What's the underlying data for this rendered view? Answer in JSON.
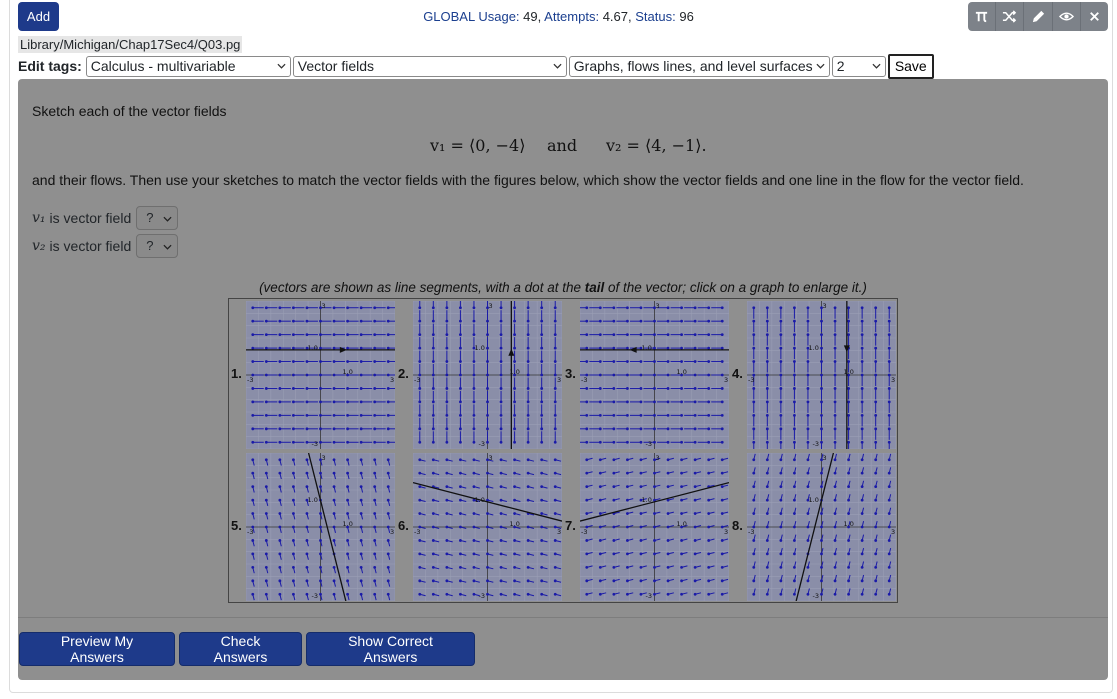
{
  "header": {
    "add_label": "Add",
    "usage": {
      "global_label": "GLOBAL Usage:",
      "global_value": "49,",
      "attempts_label": "Attempts:",
      "attempts_value": "4.67,",
      "status_label": "Status:",
      "status_value": "96"
    },
    "tools": [
      "pi-icon",
      "shuffle-icon",
      "pencil-icon",
      "eye-icon",
      "close-icon"
    ]
  },
  "file_path": "Library/Michigan/Chap17Sec4/Q03.pg",
  "tags": {
    "label": "Edit tags:",
    "subject": "Calculus - multivariable",
    "chapter": "Vector fields",
    "section": "Graphs, flows lines, and level surfaces",
    "level": "2",
    "save_label": "Save"
  },
  "problem": {
    "intro": "Sketch each of the vector fields",
    "v1_def": "v₁ = ⟨0, −4⟩",
    "and_word": "and",
    "v2_def": "v₂ = ⟨4, −1⟩.",
    "body": "and their flows. Then use your sketches to match the vector fields with the figures below, which show the vector fields and one line in the flow for the vector field.",
    "answers": [
      {
        "var": "v₁",
        "text": "is vector field",
        "value": "?"
      },
      {
        "var": "v₂",
        "text": "is vector field",
        "value": "?"
      }
    ],
    "caption_pre": "(vectors are shown as line segments, with a dot at the",
    "caption_bold": "tail",
    "caption_post": "of the vector; click on a graph to enlarge it.)",
    "graphs": [
      {
        "num": "1.",
        "axis_max": "3",
        "axis_min": "-3",
        "tick": "1.0"
      },
      {
        "num": "2.",
        "axis_max": "3",
        "axis_min": "-3",
        "tick": "1.0"
      },
      {
        "num": "3.",
        "axis_max": "3",
        "axis_min": "-3",
        "tick": "1.0"
      },
      {
        "num": "4.",
        "axis_max": "3",
        "axis_min": "-3",
        "tick": "1.0"
      },
      {
        "num": "5.",
        "axis_max": "3",
        "axis_min": "-3",
        "tick": "1.0"
      },
      {
        "num": "6.",
        "axis_max": "3",
        "axis_min": "-3",
        "tick": "1.0"
      },
      {
        "num": "7.",
        "axis_max": "3",
        "axis_min": "-3",
        "tick": "1.0"
      },
      {
        "num": "8.",
        "axis_max": "3",
        "axis_min": "-3",
        "tick": "1.0"
      }
    ]
  },
  "buttons": {
    "preview": "Preview My Answers",
    "check": "Check Answers",
    "show": "Show Correct Answers"
  },
  "colors": {
    "primary": "#1e3a8a",
    "usage_text": "#1b3f8f",
    "panel_bg": "#8f8f8f",
    "vector_color": "#1a1aa8"
  }
}
